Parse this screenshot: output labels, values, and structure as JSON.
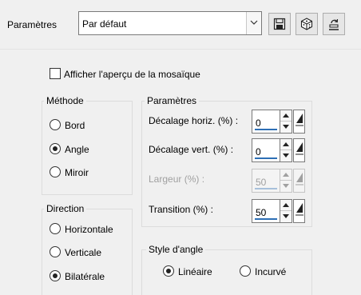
{
  "header": {
    "preset_label": "Paramètres",
    "preset_value": "Par défaut",
    "save_icon": "save-icon",
    "random_icon": "dice-icon",
    "reset_icon": "reset-icon"
  },
  "preview": {
    "label": "Afficher l'aperçu de la mosaïque",
    "checked": false
  },
  "method": {
    "title": "Méthode",
    "options": [
      {
        "label": "Bord",
        "selected": false
      },
      {
        "label": "Angle",
        "selected": true
      },
      {
        "label": "Miroir",
        "selected": false
      }
    ]
  },
  "direction": {
    "title": "Direction",
    "options": [
      {
        "label": "Horizontale",
        "selected": false
      },
      {
        "label": "Verticale",
        "selected": false
      },
      {
        "label": "Bilatérale",
        "selected": true
      }
    ]
  },
  "params": {
    "title": "Paramètres",
    "fields": [
      {
        "label": "Décalage horiz. (%) :",
        "value": "0",
        "enabled": true
      },
      {
        "label": "Décalage vert. (%) :",
        "value": "0",
        "enabled": true
      },
      {
        "label": "Largeur (%) :",
        "value": "50",
        "enabled": false
      },
      {
        "label": "Transition (%) :",
        "value": "50",
        "enabled": true
      }
    ]
  },
  "corner": {
    "title": "Style d'angle",
    "options": [
      {
        "label": "Linéaire",
        "selected": true
      },
      {
        "label": "Incurvé",
        "selected": false
      }
    ]
  },
  "colors": {
    "accent_bar": "#2d6fb5"
  }
}
